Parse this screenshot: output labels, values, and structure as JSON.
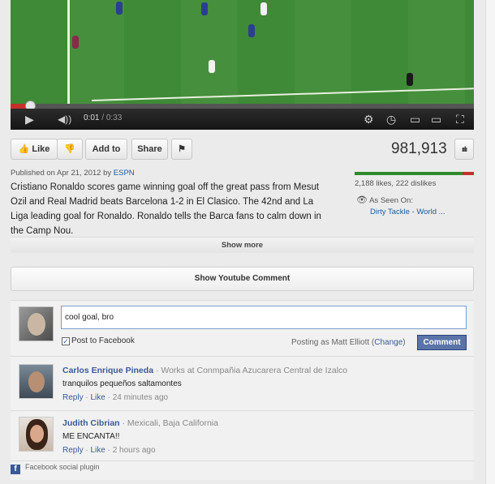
{
  "player": {
    "time_current": "0:01",
    "time_separator": " / ",
    "time_total": "0:33",
    "progress_fraction": 0.03
  },
  "actions": {
    "like_label": "Like",
    "add_to_label": "Add to",
    "share_label": "Share"
  },
  "stats": {
    "view_count": "981,913",
    "likes_dislikes": "2,188 likes, 222 dislikes",
    "like_ratio": 0.908
  },
  "description": {
    "published_prefix": "Published on Apr 21, 2012 by ",
    "channel": "ESPN",
    "text": "Cristiano Ronaldo scores game winning goal off the great pass from Mesut Ozil and Real Madrid beats Barcelona 1-2 in El Clasico. The 42nd and La Liga leading goal for Ronaldo. Ronaldo tells the Barca fans to calm down in the Camp Nou.",
    "as_seen_on_label": "As Seen On:",
    "as_seen_on_link": "Dirty Tackle - World ...",
    "show_more_label": "Show more"
  },
  "youtube_comments_button": "Show Youtube Comment",
  "facebook": {
    "compose_value": "cool goal, bro",
    "post_to_facebook_label": "Post to Facebook",
    "posting_as_prefix": "Posting as Matt Elliott (",
    "change_label": "Change",
    "posting_as_suffix": ")",
    "comment_button": "Comment",
    "comments": [
      {
        "name": "Carlos Enrique Pineda",
        "meta": " · Works at Conmpañia Azucarera Central de Izalco",
        "text": "tranquilos pequeños saltamontes",
        "reply": "Reply",
        "like": "Like",
        "time": " · 24 minutes ago"
      },
      {
        "name": "Judith Cibrian",
        "meta": " · Mexicali, Baja California",
        "text": "ME ENCANTA!!",
        "reply": "Reply",
        "like": "Like",
        "time": " · 2 hours ago"
      }
    ],
    "plugin_label": "Facebook social plugin"
  },
  "colors": {
    "youtube_red": "#c4302b",
    "facebook_blue": "#3b5998",
    "like_green": "#2d8b2d"
  }
}
